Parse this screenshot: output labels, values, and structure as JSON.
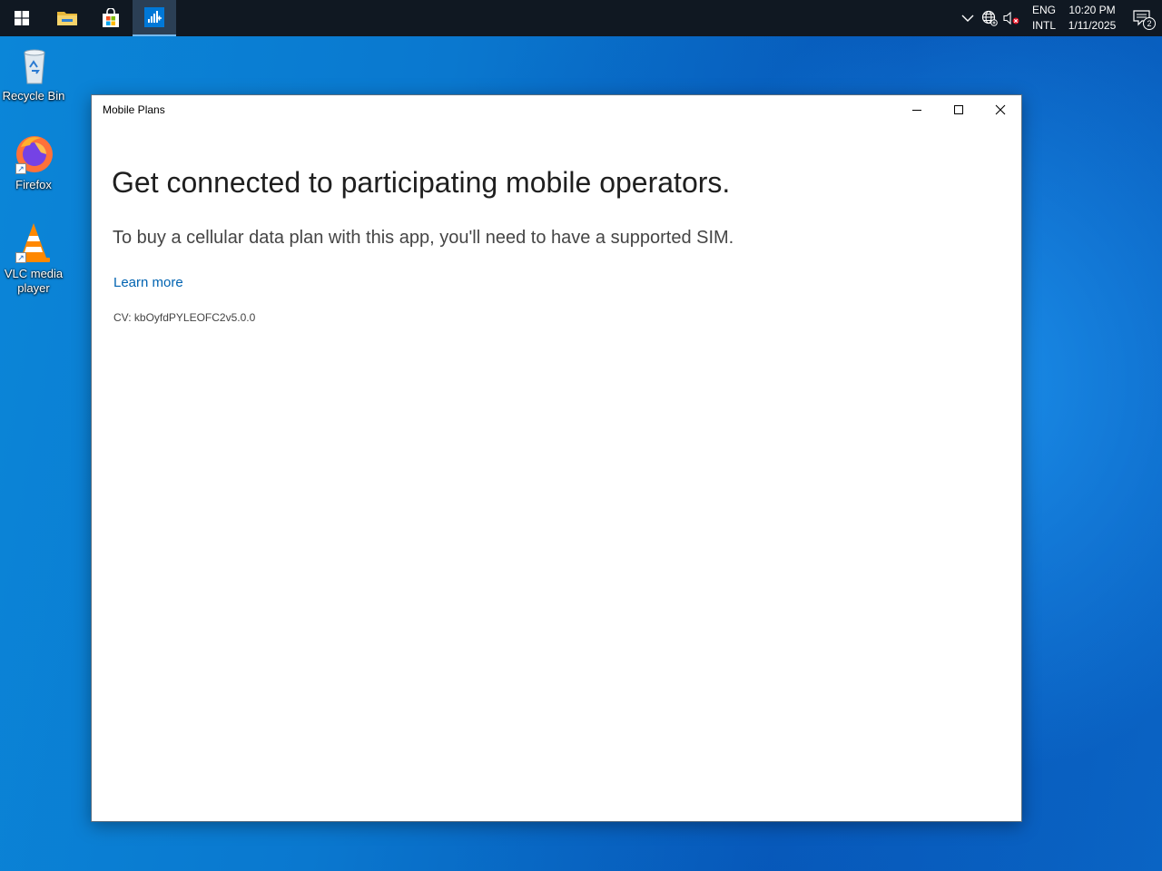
{
  "taskbar": {
    "pinned": [
      {
        "name": "start",
        "icon": "windows-logo-icon"
      },
      {
        "name": "file-explorer",
        "icon": "folder-icon"
      },
      {
        "name": "microsoft-store",
        "icon": "store-bag-icon"
      },
      {
        "name": "mobile-plans",
        "icon": "mobile-plans-icon",
        "active": true
      }
    ],
    "tray": {
      "icons": [
        "chevron-up-icon",
        "network-globe-icon",
        "volume-muted-icon"
      ],
      "language_line1": "ENG",
      "language_line2": "INTL",
      "time": "10:20 PM",
      "date": "1/11/2025",
      "notification_count": "2"
    }
  },
  "desktop": {
    "icons": [
      {
        "label": "Recycle Bin",
        "icon": "recycle-bin-icon"
      },
      {
        "label": "Firefox",
        "icon": "firefox-icon"
      },
      {
        "label": "VLC media player",
        "icon": "vlc-cone-icon"
      }
    ]
  },
  "window": {
    "title": "Mobile Plans",
    "headline": "Get connected to participating mobile operators.",
    "subtext": "To buy a cellular data plan with this app, you'll need to have a supported SIM.",
    "learn_more": "Learn more",
    "cv": "CV: kbOyfdPYLEOFC2v5.0.0"
  },
  "colors": {
    "taskbar_bg": "#101822",
    "link": "#0063b1",
    "desktop_blue": "#0a78cf"
  }
}
